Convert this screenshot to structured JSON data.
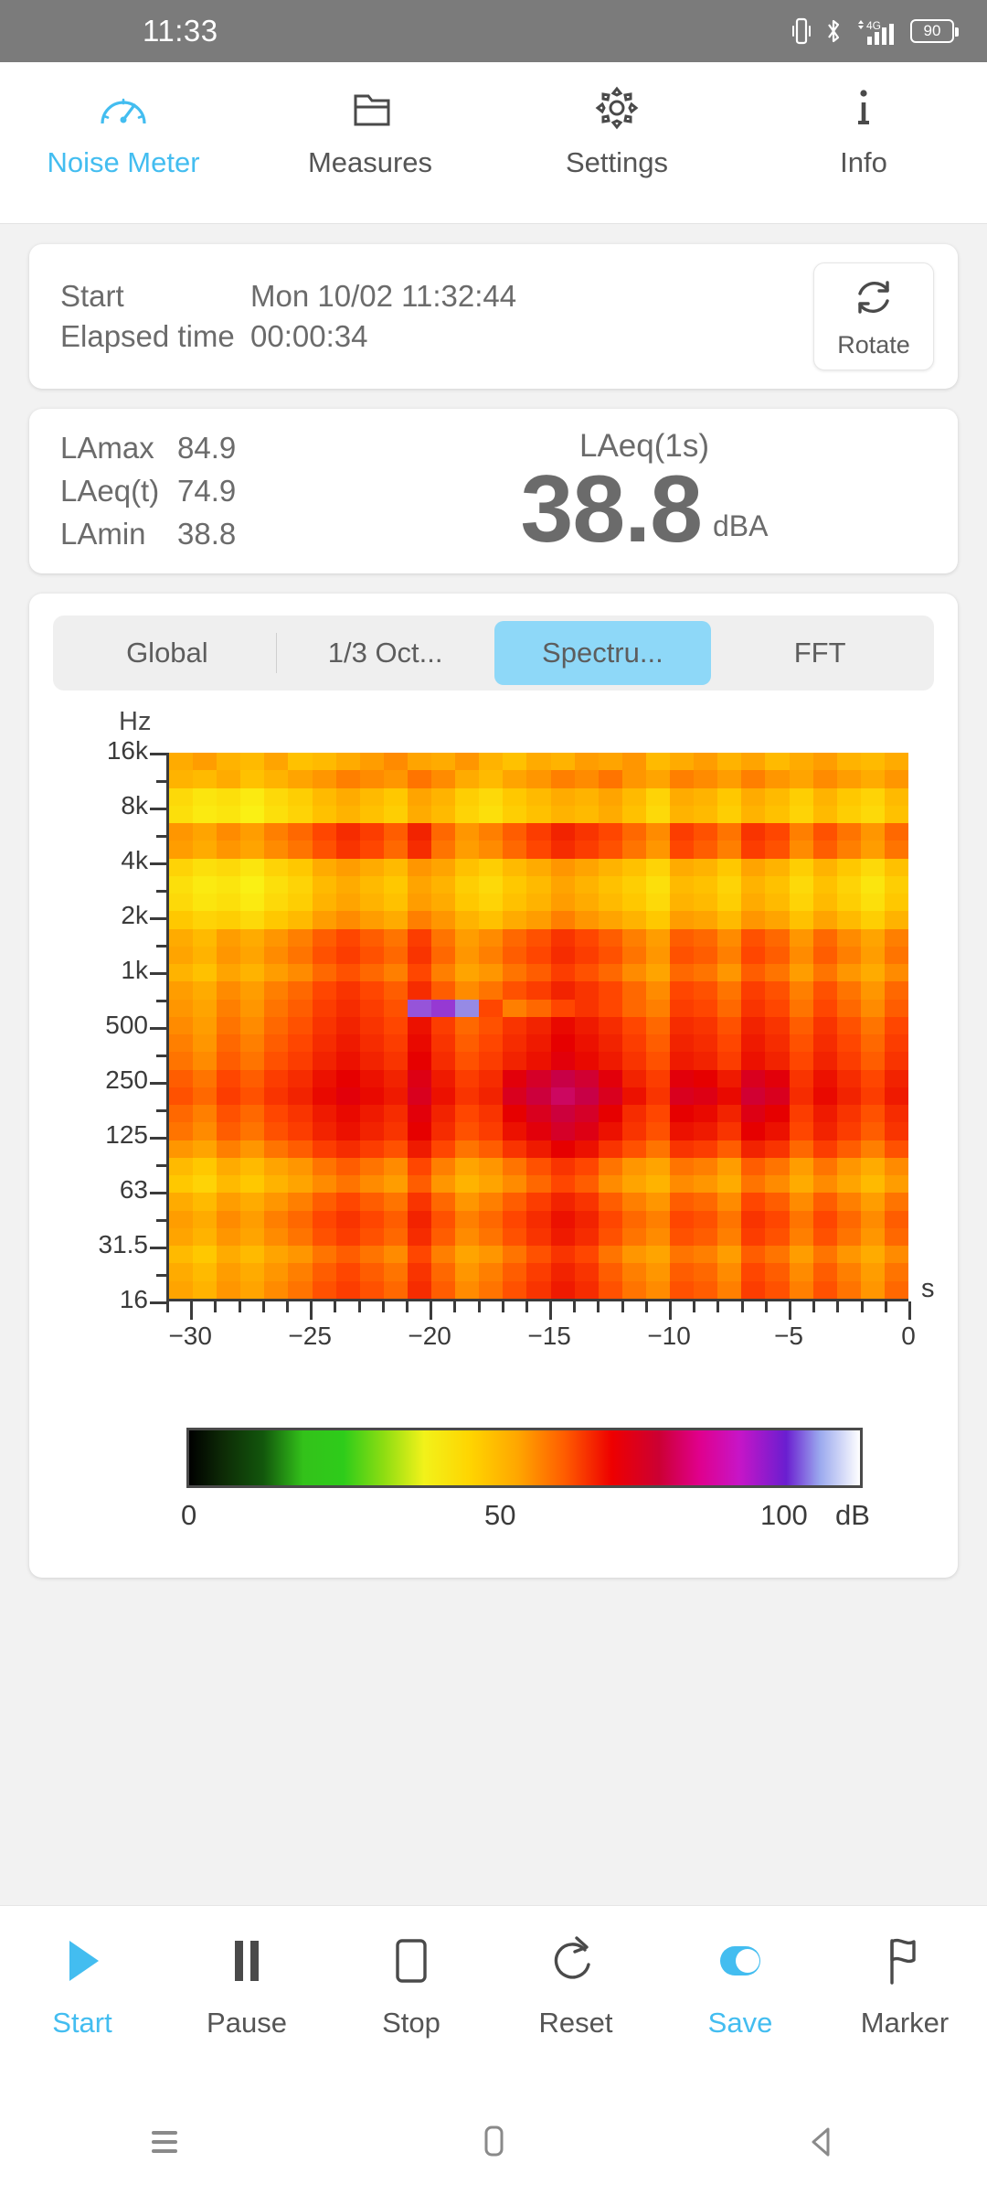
{
  "status_bar": {
    "time": "11:33",
    "battery_percent": "90",
    "icons": [
      "vibrate-icon",
      "bluetooth-icon",
      "signal-4g-icon",
      "battery-icon"
    ],
    "background": "#7b7b7b"
  },
  "top_tabs": {
    "active": "Noise Meter",
    "items": [
      {
        "label": "Noise Meter",
        "icon": "gauge-icon"
      },
      {
        "label": "Measures",
        "icon": "folder-icon"
      },
      {
        "label": "Settings",
        "icon": "gear-icon"
      },
      {
        "label": "Info",
        "icon": "info-icon"
      }
    ],
    "accent_color": "#43bdf0"
  },
  "session": {
    "start_label": "Start",
    "start_value": "Mon 10/02 11:32:44",
    "elapsed_label": "Elapsed time",
    "elapsed_value": "00:00:34",
    "rotate_label": "Rotate",
    "rotate_icon": "rotate-icon"
  },
  "levels": {
    "rows": [
      {
        "name": "LAmax",
        "value": "84.9"
      },
      {
        "name": "LAeq(t)",
        "value": "74.9"
      },
      {
        "name": "LAmin",
        "value": "38.8"
      }
    ],
    "main_title": "LAeq(1s)",
    "main_value": "38.8",
    "main_unit": "dBA"
  },
  "view_modes": {
    "active": "Spectru...",
    "items": [
      "Global",
      "1/3 Oct...",
      "Spectru...",
      "FFT"
    ],
    "active_background": "#8ed8f8"
  },
  "chart_data": {
    "type": "heatmap",
    "title": "",
    "xlabel": "s",
    "ylabel": "Hz",
    "xlim": [
      -31,
      0
    ],
    "ylim_labels": [
      "16",
      "31.5",
      "63",
      "125",
      "250",
      "500",
      "1k",
      "2k",
      "4k",
      "8k",
      "16k"
    ],
    "x_ticks": [
      -30,
      -25,
      -20,
      -15,
      -10,
      -5,
      0
    ],
    "x_tick_labels": [
      "−30",
      "−25",
      "−20",
      "−15",
      "−10",
      "−5",
      "0"
    ],
    "y_ticks": [
      "16k",
      "8k",
      "4k",
      "2k",
      "1k",
      "500",
      "250",
      "125",
      "63",
      "31.5",
      "16"
    ],
    "colorbar": {
      "min": 0,
      "max": 100,
      "unit": "dB",
      "tick_labels": [
        "0",
        "50",
        "100"
      ],
      "stops": [
        "#000000",
        "#12560c",
        "#2ecc1a",
        "#8ddd12",
        "#f2f21a",
        "#ffd400",
        "#ffa600",
        "#ff5c00",
        "#ee0000",
        "#e0008c",
        "#c715c7",
        "#6a1ed0",
        "#ffffff"
      ]
    },
    "n_columns": 31,
    "n_rows": 31,
    "values": [
      [
        52,
        54,
        51,
        50,
        53,
        49,
        50,
        52,
        54,
        56,
        53,
        52,
        55,
        51,
        49,
        52,
        51,
        54,
        53,
        55,
        50,
        52,
        54,
        51,
        53,
        50,
        52,
        54,
        51,
        50,
        52
      ],
      [
        51,
        50,
        52,
        49,
        51,
        53,
        55,
        57,
        56,
        55,
        58,
        56,
        52,
        50,
        53,
        55,
        57,
        56,
        58,
        55,
        53,
        57,
        56,
        54,
        57,
        55,
        53,
        56,
        54,
        52,
        55
      ],
      [
        45,
        43,
        44,
        42,
        45,
        47,
        50,
        52,
        50,
        48,
        53,
        51,
        47,
        45,
        48,
        50,
        52,
        51,
        53,
        50,
        46,
        52,
        51,
        48,
        52,
        50,
        47,
        51,
        48,
        46,
        50
      ],
      [
        44,
        42,
        43,
        41,
        44,
        46,
        49,
        51,
        49,
        47,
        52,
        50,
        46,
        44,
        47,
        49,
        51,
        50,
        52,
        49,
        45,
        51,
        50,
        47,
        51,
        49,
        46,
        50,
        47,
        45,
        49
      ],
      [
        55,
        53,
        56,
        54,
        57,
        59,
        62,
        65,
        63,
        60,
        66,
        59,
        55,
        57,
        60,
        63,
        66,
        64,
        62,
        59,
        56,
        63,
        61,
        58,
        64,
        62,
        57,
        61,
        58,
        55,
        59
      ],
      [
        54,
        52,
        55,
        53,
        56,
        58,
        61,
        64,
        62,
        59,
        65,
        58,
        54,
        56,
        59,
        62,
        65,
        63,
        61,
        58,
        55,
        62,
        60,
        57,
        63,
        61,
        56,
        60,
        57,
        54,
        58
      ],
      [
        46,
        44,
        45,
        43,
        46,
        48,
        52,
        54,
        52,
        50,
        55,
        53,
        49,
        47,
        50,
        52,
        55,
        53,
        51,
        49,
        46,
        52,
        51,
        48,
        53,
        51,
        47,
        51,
        48,
        45,
        49
      ],
      [
        44,
        42,
        43,
        41,
        44,
        46,
        50,
        52,
        50,
        48,
        53,
        51,
        47,
        45,
        48,
        50,
        53,
        51,
        49,
        47,
        44,
        50,
        49,
        46,
        51,
        49,
        45,
        49,
        46,
        43,
        47
      ],
      [
        45,
        43,
        44,
        42,
        45,
        47,
        51,
        53,
        51,
        49,
        54,
        52,
        48,
        46,
        49,
        51,
        54,
        52,
        50,
        48,
        45,
        51,
        50,
        47,
        52,
        50,
        46,
        50,
        47,
        44,
        48
      ],
      [
        48,
        46,
        47,
        45,
        48,
        50,
        54,
        56,
        54,
        52,
        57,
        55,
        51,
        49,
        52,
        54,
        57,
        55,
        53,
        51,
        48,
        54,
        53,
        50,
        55,
        53,
        49,
        53,
        50,
        47,
        51
      ],
      [
        52,
        50,
        54,
        52,
        55,
        57,
        60,
        62,
        60,
        58,
        63,
        58,
        54,
        56,
        59,
        61,
        64,
        62,
        60,
        57,
        54,
        60,
        59,
        56,
        61,
        59,
        55,
        59,
        56,
        53,
        57
      ],
      [
        53,
        51,
        55,
        53,
        56,
        58,
        61,
        63,
        61,
        59,
        64,
        59,
        55,
        57,
        60,
        62,
        65,
        63,
        61,
        58,
        55,
        61,
        60,
        57,
        62,
        60,
        56,
        60,
        57,
        54,
        58
      ],
      [
        51,
        49,
        53,
        51,
        54,
        56,
        59,
        61,
        59,
        57,
        62,
        57,
        53,
        55,
        58,
        60,
        63,
        61,
        59,
        56,
        53,
        59,
        58,
        55,
        60,
        58,
        54,
        58,
        55,
        52,
        56
      ],
      [
        54,
        52,
        56,
        54,
        57,
        59,
        62,
        64,
        62,
        60,
        65,
        60,
        56,
        58,
        61,
        63,
        66,
        64,
        62,
        59,
        56,
        62,
        61,
        58,
        63,
        61,
        57,
        61,
        58,
        55,
        59
      ],
      [
        55,
        53,
        57,
        55,
        58,
        60,
        63,
        65,
        63,
        61,
        92,
        91,
        94,
        62,
        57,
        59,
        62,
        64,
        62,
        59,
        57,
        63,
        62,
        59,
        64,
        62,
        58,
        62,
        59,
        56,
        60
      ],
      [
        56,
        54,
        58,
        56,
        59,
        61,
        64,
        66,
        64,
        62,
        68,
        63,
        59,
        61,
        64,
        66,
        69,
        67,
        65,
        62,
        59,
        65,
        64,
        61,
        66,
        64,
        60,
        64,
        61,
        58,
        62
      ],
      [
        57,
        55,
        59,
        57,
        60,
        62,
        65,
        67,
        65,
        63,
        69,
        64,
        60,
        62,
        65,
        67,
        70,
        68,
        66,
        63,
        60,
        66,
        65,
        62,
        67,
        65,
        61,
        65,
        62,
        59,
        63
      ],
      [
        58,
        56,
        60,
        58,
        61,
        63,
        66,
        68,
        66,
        64,
        70,
        65,
        61,
        63,
        66,
        68,
        71,
        69,
        67,
        64,
        61,
        67,
        66,
        63,
        68,
        66,
        62,
        66,
        63,
        60,
        64
      ],
      [
        60,
        58,
        62,
        60,
        63,
        65,
        68,
        70,
        68,
        66,
        72,
        67,
        63,
        65,
        71,
        74,
        77,
        75,
        71,
        66,
        63,
        71,
        70,
        67,
        73,
        71,
        64,
        68,
        65,
        62,
        66
      ],
      [
        61,
        59,
        63,
        61,
        64,
        66,
        69,
        71,
        69,
        67,
        73,
        68,
        64,
        66,
        73,
        76,
        79,
        77,
        73,
        68,
        64,
        73,
        72,
        69,
        75,
        73,
        65,
        69,
        66,
        63,
        67
      ],
      [
        59,
        57,
        61,
        59,
        62,
        64,
        67,
        69,
        67,
        65,
        71,
        66,
        62,
        64,
        70,
        73,
        76,
        74,
        70,
        65,
        62,
        70,
        69,
        66,
        72,
        70,
        63,
        67,
        64,
        61,
        65
      ],
      [
        58,
        56,
        60,
        58,
        61,
        63,
        66,
        68,
        66,
        64,
        70,
        65,
        61,
        63,
        68,
        71,
        74,
        72,
        68,
        64,
        61,
        68,
        67,
        64,
        70,
        68,
        62,
        66,
        63,
        60,
        64
      ],
      [
        55,
        53,
        57,
        55,
        58,
        60,
        63,
        65,
        63,
        61,
        67,
        62,
        58,
        60,
        64,
        67,
        70,
        68,
        64,
        61,
        58,
        64,
        63,
        60,
        66,
        64,
        59,
        63,
        60,
        57,
        61
      ],
      [
        50,
        48,
        52,
        50,
        53,
        55,
        58,
        60,
        58,
        56,
        62,
        57,
        53,
        55,
        58,
        61,
        64,
        62,
        58,
        55,
        53,
        58,
        57,
        54,
        60,
        58,
        54,
        58,
        55,
        52,
        56
      ],
      [
        48,
        46,
        50,
        48,
        51,
        53,
        56,
        58,
        56,
        54,
        60,
        55,
        51,
        53,
        56,
        59,
        62,
        60,
        56,
        53,
        51,
        56,
        55,
        52,
        58,
        56,
        52,
        56,
        53,
        50,
        54
      ],
      [
        52,
        50,
        54,
        52,
        55,
        57,
        60,
        62,
        60,
        58,
        64,
        59,
        55,
        57,
        60,
        63,
        66,
        64,
        60,
        57,
        55,
        60,
        59,
        56,
        62,
        60,
        56,
        60,
        57,
        54,
        58
      ],
      [
        54,
        52,
        56,
        54,
        57,
        59,
        62,
        64,
        62,
        60,
        66,
        61,
        57,
        59,
        62,
        65,
        68,
        66,
        62,
        59,
        57,
        62,
        61,
        58,
        64,
        62,
        58,
        62,
        59,
        56,
        60
      ],
      [
        53,
        51,
        55,
        53,
        56,
        58,
        61,
        63,
        61,
        59,
        65,
        60,
        56,
        58,
        61,
        64,
        67,
        65,
        61,
        58,
        56,
        61,
        60,
        57,
        63,
        61,
        57,
        61,
        58,
        55,
        59
      ],
      [
        50,
        48,
        52,
        50,
        53,
        55,
        58,
        60,
        58,
        56,
        62,
        57,
        53,
        55,
        58,
        61,
        64,
        62,
        58,
        55,
        53,
        58,
        57,
        54,
        60,
        58,
        54,
        58,
        55,
        52,
        56
      ],
      [
        52,
        50,
        54,
        52,
        55,
        57,
        60,
        62,
        60,
        58,
        64,
        59,
        55,
        57,
        60,
        63,
        66,
        64,
        60,
        57,
        55,
        60,
        59,
        56,
        62,
        60,
        56,
        60,
        57,
        54,
        58
      ],
      [
        53,
        51,
        55,
        53,
        56,
        58,
        61,
        63,
        61,
        59,
        65,
        60,
        56,
        58,
        61,
        64,
        67,
        65,
        61,
        58,
        56,
        61,
        60,
        57,
        63,
        61,
        57,
        61,
        58,
        55,
        59
      ]
    ]
  },
  "bottom_toolbar": {
    "items": [
      {
        "label": "Start",
        "icon": "play-icon",
        "accent": true
      },
      {
        "label": "Pause",
        "icon": "pause-icon",
        "accent": false
      },
      {
        "label": "Stop",
        "icon": "stop-icon",
        "accent": false
      },
      {
        "label": "Reset",
        "icon": "reset-icon",
        "accent": false
      },
      {
        "label": "Save",
        "icon": "toggle-on-icon",
        "accent": true
      },
      {
        "label": "Marker",
        "icon": "flag-icon",
        "accent": false
      }
    ]
  },
  "nav_bar": {
    "items": [
      "recents-icon",
      "home-icon",
      "back-icon"
    ]
  }
}
